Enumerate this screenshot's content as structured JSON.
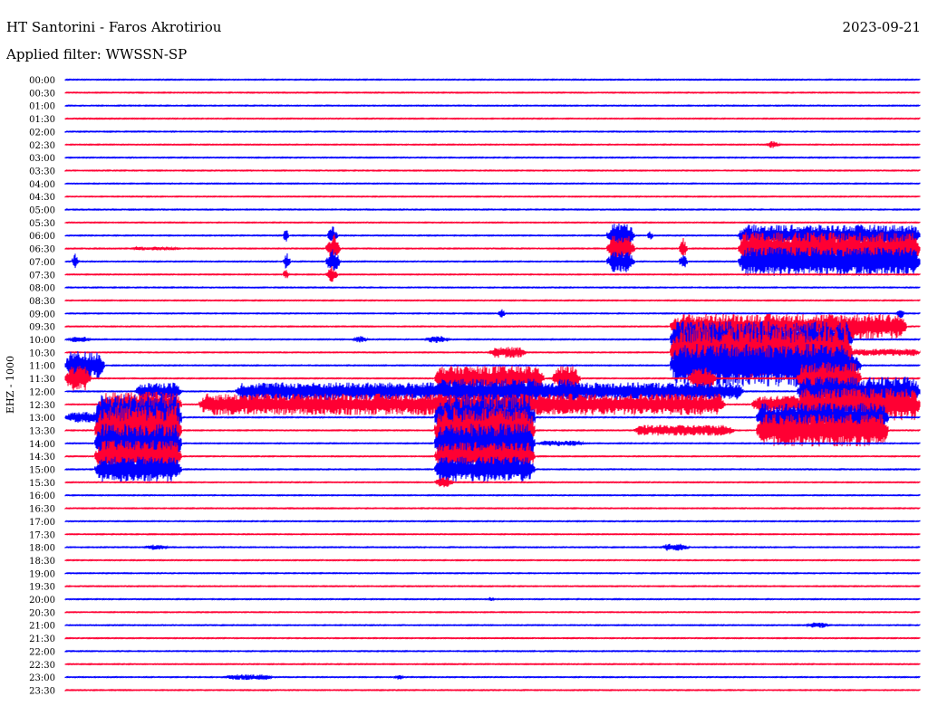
{
  "header": {
    "station": "HT Santorini - Faros Akrotiriou",
    "date": "2023-09-21",
    "filter": "Applied filter: WWSSN-SP"
  },
  "chart_data": {
    "type": "seismogram",
    "channel_label": "EHZ - 1000",
    "trace_colors": [
      "#0000ff",
      "#ff0033"
    ],
    "rows": [
      "00:00",
      "00:30",
      "01:00",
      "01:30",
      "02:00",
      "02:30",
      "03:00",
      "03:30",
      "04:00",
      "04:30",
      "05:00",
      "05:30",
      "06:00",
      "06:30",
      "07:00",
      "07:30",
      "08:00",
      "08:30",
      "09:00",
      "09:30",
      "10:00",
      "10:30",
      "11:00",
      "11:30",
      "12:00",
      "12:30",
      "13:00",
      "13:30",
      "14:00",
      "14:30",
      "15:00",
      "15:30",
      "16:00",
      "16:30",
      "17:00",
      "17:30",
      "18:00",
      "18:30",
      "19:00",
      "19:30",
      "20:00",
      "20:30",
      "21:00",
      "21:30",
      "22:00",
      "22:30",
      "23:00",
      "23:30"
    ]
  }
}
